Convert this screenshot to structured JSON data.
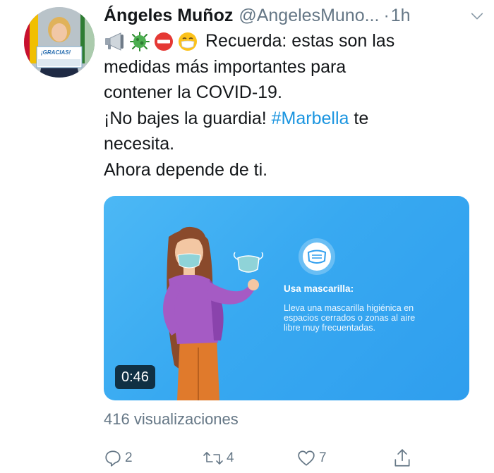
{
  "tweet": {
    "author_name": "Ángeles Muñoz",
    "author_handle": "@AngelesMuno...",
    "separator": "·",
    "time": "1h",
    "text_line1": "Recuerda: estas son las",
    "text_line2": "medidas más importantes para",
    "text_line3": "contener la COVID-19.",
    "text_line4_before": "¡No bajes la guardia! ",
    "hashtag": "#Marbella",
    "text_line4_after": " te",
    "text_line5": "necesita.",
    "text_line6": "Ahora depende de ti."
  },
  "avatar": {
    "sign_text": "¡GRACIAS!"
  },
  "media": {
    "duration": "0:46",
    "info_title": "Usa mascarilla:",
    "info_description": "Lleva una mascarilla higiénica en espacios cerrados o zonas al aire libre muy frecuentadas."
  },
  "stats": {
    "views_label": "416 visualizaciones"
  },
  "actions": {
    "reply_count": "2",
    "retweet_count": "4",
    "like_count": "7"
  },
  "icons": {
    "emojis": [
      "loudspeaker-icon",
      "microbe-icon",
      "no-entry-icon",
      "face-with-mask-icon"
    ],
    "caret": "chevron-down-icon",
    "reply": "reply-icon",
    "retweet": "retweet-icon",
    "like": "heart-icon",
    "share": "share-icon"
  },
  "colors": {
    "link": "#1b95e0",
    "secondary_text": "#657786",
    "media_background": "#38a9f1"
  }
}
